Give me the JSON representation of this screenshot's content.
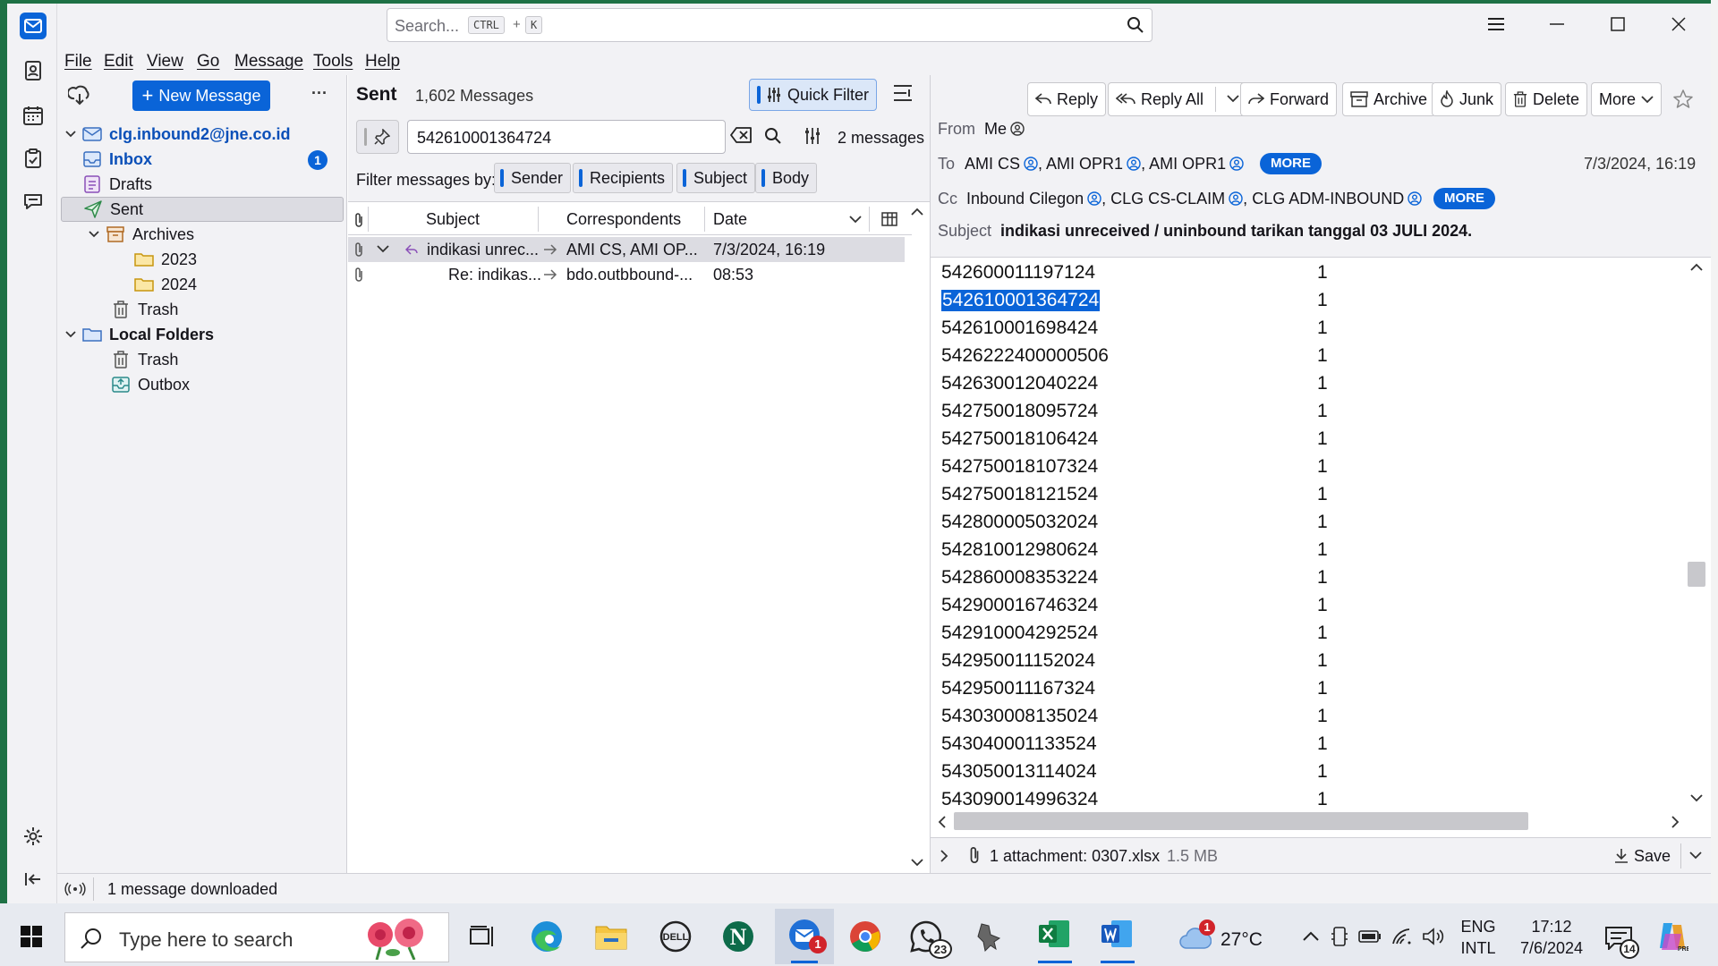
{
  "search": {
    "placeholder": "Search...",
    "key1": "CTRL",
    "plus": "+",
    "key2": "K"
  },
  "menu": [
    "File",
    "Edit",
    "View",
    "Go",
    "Message",
    "Tools",
    "Help"
  ],
  "folder_pane": {
    "new_message_label": "New Message",
    "more": "···",
    "account": "clg.inbound2@jne.co.id",
    "folders": [
      {
        "label": "Inbox",
        "badge": "1",
        "icon": "inbox-icon"
      },
      {
        "label": "Drafts",
        "icon": "drafts-icon"
      },
      {
        "label": "Sent",
        "icon": "sent-icon"
      },
      {
        "label": "Archives",
        "icon": "archive-icon"
      },
      {
        "label": "2023",
        "icon": "folder-icon"
      },
      {
        "label": "2024",
        "icon": "folder-icon"
      },
      {
        "label": "Trash",
        "icon": "trash-icon"
      }
    ],
    "local_folders": "Local Folders",
    "local": [
      {
        "label": "Trash",
        "icon": "trash-icon"
      },
      {
        "label": "Outbox",
        "icon": "outbox-icon"
      }
    ]
  },
  "thread_pane": {
    "folder_name": "Sent",
    "count": "1,602 Messages",
    "quick_filter": "Quick Filter",
    "filter_value": "542610001364724",
    "results": "2 messages",
    "filter_by_label": "Filter messages by:",
    "filter_chips": [
      "Sender",
      "Recipients",
      "Subject",
      "Body"
    ],
    "columns": {
      "subject": "Subject",
      "correspondents": "Correspondents",
      "date": "Date"
    },
    "rows": [
      {
        "subject": "indikasi unrec...",
        "correspondents": "AMI CS, AMI OP...",
        "date": "7/3/2024, 16:19"
      },
      {
        "subject": "Re: indikas...",
        "correspondents": "bdo.outbbound-...",
        "date": "08:53"
      }
    ]
  },
  "message": {
    "toolbar": [
      "Reply",
      "Reply All",
      "Forward",
      "Archive",
      "Junk",
      "Delete",
      "More"
    ],
    "from_label": "From",
    "from": "Me",
    "to_label": "To",
    "to": [
      "AMI CS",
      "AMI OPR1",
      "AMI OPR1"
    ],
    "cc_label": "Cc",
    "cc": [
      "Inbound Cilegon",
      "CLG CS-CLAIM",
      "CLG ADM-INBOUND"
    ],
    "more_label": "MORE",
    "date": "7/3/2024, 16:19",
    "subject_label": "Subject",
    "subject": "indikasi unreceived / uninbound tarikan tanggal 03 JULI 2024.",
    "sheet_rows": [
      {
        "num": "542600011197124",
        "count": "1"
      },
      {
        "num": "542610001364724",
        "count": "1",
        "selected": true
      },
      {
        "num": "542610001698424",
        "count": "1"
      },
      {
        "num": "5426222400000506",
        "count": "1"
      },
      {
        "num": "542630012040224",
        "count": "1"
      },
      {
        "num": "542750018095724",
        "count": "1"
      },
      {
        "num": "542750018106424",
        "count": "1"
      },
      {
        "num": "542750018107324",
        "count": "1"
      },
      {
        "num": "542750018121524",
        "count": "1"
      },
      {
        "num": "542800005032024",
        "count": "1"
      },
      {
        "num": "542810012980624",
        "count": "1"
      },
      {
        "num": "542860008353224",
        "count": "1"
      },
      {
        "num": "542900016746324",
        "count": "1"
      },
      {
        "num": "542910004292524",
        "count": "1"
      },
      {
        "num": "542950011152024",
        "count": "1"
      },
      {
        "num": "542950011167324",
        "count": "1"
      },
      {
        "num": "543030008135024",
        "count": "1"
      },
      {
        "num": "543040001133524",
        "count": "1"
      },
      {
        "num": "543050013114024",
        "count": "1"
      },
      {
        "num": "543090014996324",
        "count": "1"
      }
    ],
    "attachment": "1 attachment: 0307.xlsx",
    "attachment_size": "1.5 MB",
    "save": "Save"
  },
  "status": {
    "text": "1 message downloaded"
  },
  "taskbar": {
    "search_placeholder": "Type here to search",
    "weather": "27°C",
    "weather_badge": "1",
    "lang1": "ENG",
    "lang2": "INTL",
    "time": "17:12",
    "date": "7/6/2024",
    "notif_count": "14",
    "thunderbird_badge": "1",
    "whatsapp_badge": "23"
  },
  "colors": {
    "accent": "#0a64d8",
    "pane": "#f2f2f5",
    "excel": "#1e7145"
  }
}
